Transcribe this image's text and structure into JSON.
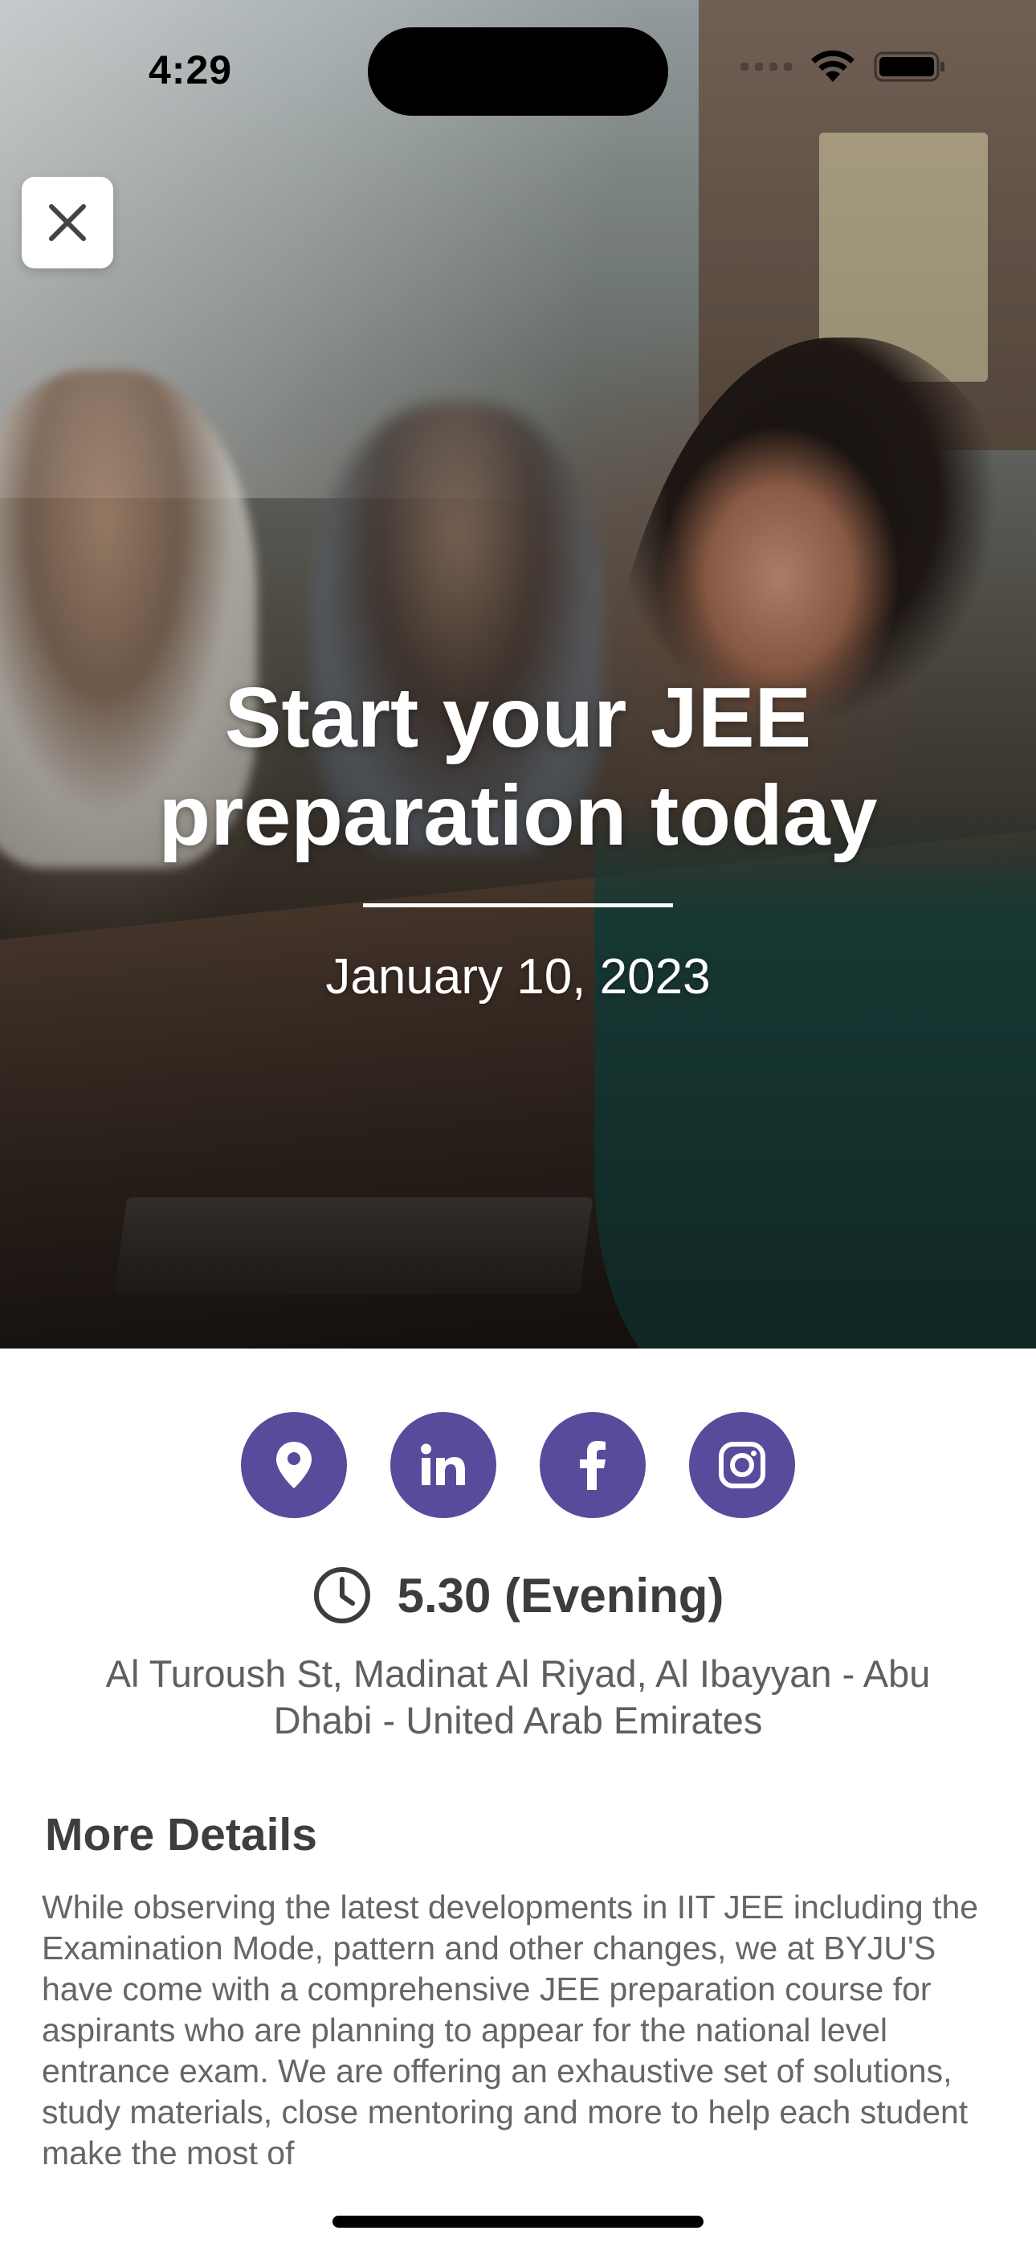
{
  "status_bar": {
    "time": "4:29"
  },
  "hero": {
    "title": "Start your JEE preparation today",
    "date": "January 10, 2023"
  },
  "social": {
    "items": [
      {
        "icon": "location-pin-icon"
      },
      {
        "icon": "linkedin-icon"
      },
      {
        "icon": "facebook-icon"
      },
      {
        "icon": "instagram-icon"
      }
    ],
    "accent_color": "#5a4a9c"
  },
  "event": {
    "time": "5.30 (Evening)",
    "address": "Al Turoush St, Madinat Al Riyad, Al  Ibayyan - Abu Dhabi - United Arab Emirates"
  },
  "details": {
    "title": "More Details",
    "body": "While observing the latest developments in IIT JEE including the Examination Mode, pattern and other changes, we at BYJU'S have come with a comprehensive JEE preparation course for aspirants who are planning to appear for the national level entrance exam. We are offering an exhaustive set of solutions, study materials, close mentoring and more to help each student make the most of"
  }
}
